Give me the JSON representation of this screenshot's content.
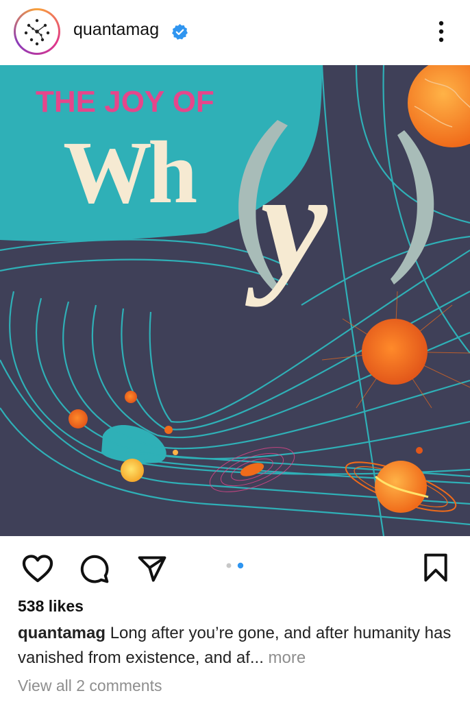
{
  "post": {
    "username": "quantamag",
    "image": {
      "line1": "THE JOY OF",
      "word_wh": "Wh",
      "word_y": "y",
      "colors": {
        "teal": "#2fb0b7",
        "navy": "#3f4058",
        "pink": "#e5468b",
        "cream": "#f6ead2",
        "orange": "#f27b1e",
        "grey_paren": "#a8bcb8"
      }
    },
    "likes": "538 likes",
    "caption_user": "quantamag",
    "caption_text": "Long after you’re gone, and after humanity has vanished from existence, and af",
    "caption_ellipsis": "...",
    "caption_more": "more",
    "view_comments": "View all 2 comments",
    "carousel": {
      "current": 2,
      "total": 2
    }
  },
  "icons": {
    "like": "heart-icon",
    "comment": "comment-icon",
    "share": "send-icon",
    "save": "bookmark-icon",
    "options": "more-vertical-icon",
    "verified": "verified-badge-icon"
  }
}
